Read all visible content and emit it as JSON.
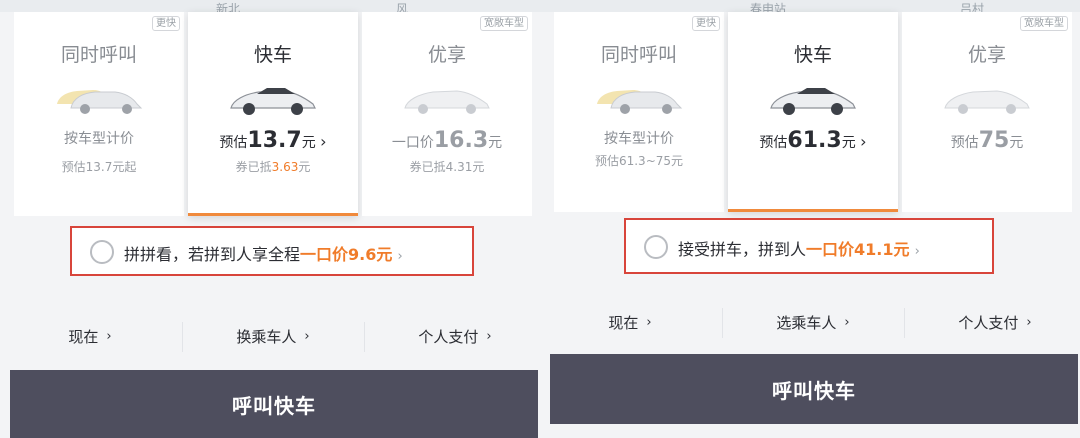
{
  "colors": {
    "accent_orange": "#f07c2a",
    "highlight_border": "#d8453b",
    "call_button_bg": "#4e4e5e",
    "sheet_bg": "#f3f4f6"
  },
  "left": {
    "map_labels": [
      "新北",
      "风"
    ],
    "cards": [
      {
        "title": "同时呼叫",
        "tag": "更快",
        "car_icon": "car-pair-icon",
        "price_prefix": "按车型计价",
        "price": "",
        "price_suffix": "",
        "chevron": "",
        "sub": "预估13.7元起",
        "sub_highlight": "",
        "sub_suffix": ""
      },
      {
        "title": "快车",
        "tag": "",
        "car_icon": "car-icon",
        "price_prefix": "预估",
        "price": "13.7",
        "price_suffix": "元",
        "chevron": "›",
        "sub": "券已抵",
        "sub_highlight": "3.63",
        "sub_suffix": "元"
      },
      {
        "title": "优享",
        "tag": "宽敞车型",
        "car_icon": "premium-car-icon",
        "price_prefix": "一口价",
        "price": "16.3",
        "price_suffix": "元",
        "chevron": "",
        "sub": "券已抵4.31元",
        "sub_highlight": "",
        "sub_suffix": ""
      }
    ],
    "carpool": {
      "text": "拼拼看，若拼到人享全程",
      "highlight": "一口价9.6元",
      "chevron": "›"
    },
    "options": [
      {
        "label": "现在",
        "chevron": "›"
      },
      {
        "label": "换乘车人",
        "chevron": "›"
      },
      {
        "label": "个人支付",
        "chevron": "›"
      }
    ],
    "call_button": "呼叫快车"
  },
  "right": {
    "map_labels": [
      "春申站",
      "吕村"
    ],
    "cards": [
      {
        "title": "同时呼叫",
        "tag": "更快",
        "car_icon": "car-pair-icon",
        "price_prefix": "按车型计价",
        "price": "",
        "price_suffix": "",
        "chevron": "",
        "sub": "预估61.3~75元",
        "sub_highlight": "",
        "sub_suffix": ""
      },
      {
        "title": "快车",
        "tag": "",
        "car_icon": "car-icon",
        "price_prefix": "预估",
        "price": "61.3",
        "price_suffix": "元",
        "chevron": "›",
        "sub": "",
        "sub_highlight": "",
        "sub_suffix": ""
      },
      {
        "title": "优享",
        "tag": "宽敞车型",
        "car_icon": "premium-car-icon",
        "price_prefix": "预估",
        "price": "75",
        "price_suffix": "元",
        "chevron": "",
        "sub": "",
        "sub_highlight": "",
        "sub_suffix": ""
      }
    ],
    "carpool": {
      "text": "接受拼车，拼到人",
      "highlight": "一口价41.1元",
      "chevron": "›"
    },
    "options": [
      {
        "label": "现在",
        "chevron": "›"
      },
      {
        "label": "选乘车人",
        "chevron": "›"
      },
      {
        "label": "个人支付",
        "chevron": "›"
      }
    ],
    "call_button": "呼叫快车"
  }
}
